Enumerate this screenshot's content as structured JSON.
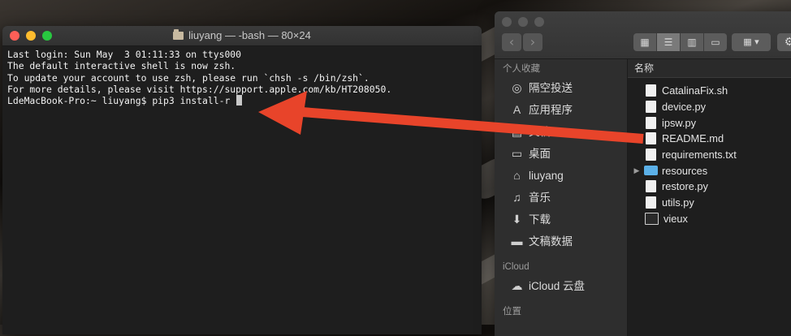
{
  "terminal": {
    "title": "liuyang — -bash — 80×24",
    "lines": [
      "Last login: Sun May  3 01:11:33 on ttys000",
      "",
      "The default interactive shell is now zsh.",
      "To update your account to use zsh, please run `chsh -s /bin/zsh`.",
      "For more details, please visit https://support.apple.com/kb/HT208050."
    ],
    "prompt": "LdeMacBook-Pro:~ liuyang$ ",
    "command": "pip3 install-r "
  },
  "finder": {
    "nav": {
      "back_glyph": "‹",
      "forward_glyph": "›"
    },
    "view_glyphs": [
      "▦",
      "☰",
      "▥",
      "▭"
    ],
    "arrange_glyph": "▦ ▾",
    "action_glyph": "⚙",
    "sidebar": {
      "favorites_header": "个人收藏",
      "favorites": [
        {
          "label": "隔空投送",
          "icon": "airdrop-icon",
          "glyph": "◎"
        },
        {
          "label": "应用程序",
          "icon": "applications-icon",
          "glyph": "A"
        },
        {
          "label": "文稿",
          "icon": "documents-icon",
          "glyph": "▤"
        },
        {
          "label": "桌面",
          "icon": "desktop-icon",
          "glyph": "▭"
        },
        {
          "label": "liuyang",
          "icon": "home-icon",
          "glyph": "⌂"
        },
        {
          "label": "音乐",
          "icon": "music-icon",
          "glyph": "♫"
        },
        {
          "label": "下载",
          "icon": "downloads-icon",
          "glyph": "⬇"
        },
        {
          "label": "文稿数据",
          "icon": "folder-icon",
          "glyph": "▬"
        }
      ],
      "icloud_header": "iCloud",
      "icloud": [
        {
          "label": "iCloud 云盘",
          "icon": "icloud-icon",
          "glyph": "☁"
        }
      ],
      "locations_header": "位置"
    },
    "column_header": "名称",
    "files": [
      {
        "name": "CatalinaFix.sh",
        "kind": "file"
      },
      {
        "name": "device.py",
        "kind": "file"
      },
      {
        "name": "ipsw.py",
        "kind": "file"
      },
      {
        "name": "README.md",
        "kind": "file"
      },
      {
        "name": "requirements.txt",
        "kind": "file"
      },
      {
        "name": "resources",
        "kind": "folder",
        "disclosure": "▶"
      },
      {
        "name": "restore.py",
        "kind": "file"
      },
      {
        "name": "utils.py",
        "kind": "file"
      },
      {
        "name": "vieux",
        "kind": "exec"
      }
    ]
  },
  "annotation": {
    "arrow_color": "#e8442a"
  }
}
